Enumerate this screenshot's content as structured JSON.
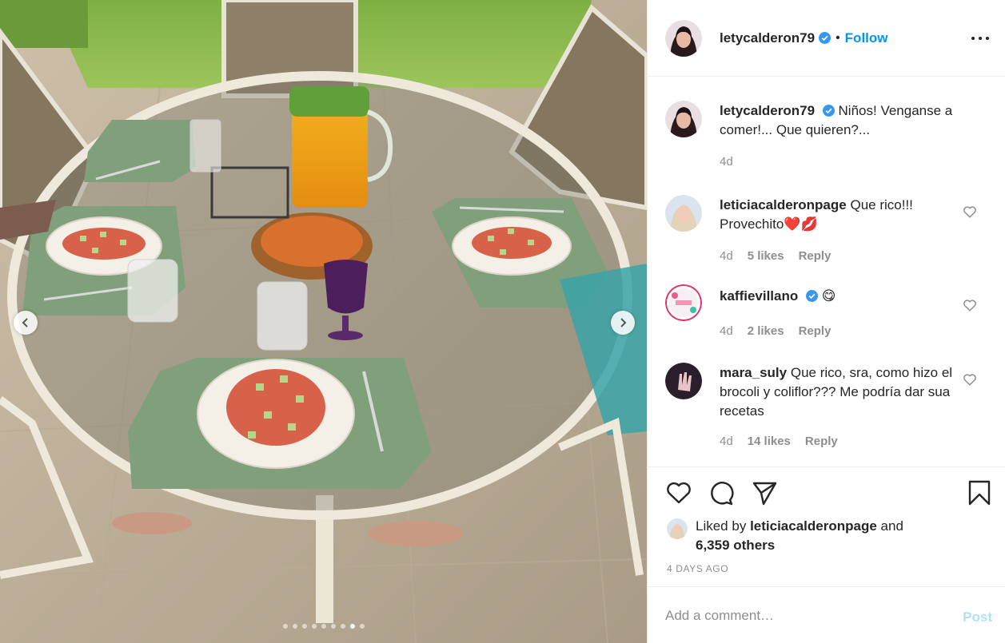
{
  "post": {
    "author": "letycalderon79",
    "follow_label": "Follow",
    "bullet": "•",
    "more_icon": "more-options-icon",
    "caption": {
      "username": "letycalderon79",
      "text": "Niños! Venganse a comer!... Que quieren?...",
      "age": "4d"
    },
    "comments": [
      {
        "username": "leticiacalderonpage",
        "text": "Que rico!!! Provechito",
        "emoji": "❤️💋",
        "age": "4d",
        "likes": "5 likes",
        "reply": "Reply"
      },
      {
        "username": "kaffievillano",
        "text": "",
        "emoji": "😋",
        "age": "4d",
        "likes": "2 likes",
        "reply": "Reply"
      },
      {
        "username": "mara_suly",
        "text": "Que rico, sra, como hizo el brocoli y coliflor??? Me podría dar sua recetas",
        "emoji": "",
        "age": "4d",
        "likes": "14 likes",
        "reply": "Reply"
      }
    ],
    "liked_by": {
      "prefix": "Liked by",
      "user": "leticiacalderonpage",
      "joiner": "and",
      "others": "6,359 others"
    },
    "time_ago": "4 DAYS AGO",
    "add_comment_placeholder": "Add a comment…",
    "post_label": "Post",
    "carousel": {
      "count": 9,
      "active_index": 7
    }
  },
  "colors": {
    "accent": "#0095f6",
    "post_disabled": "#b2dffc",
    "muted": "#8e8e8e",
    "text": "#262626"
  }
}
